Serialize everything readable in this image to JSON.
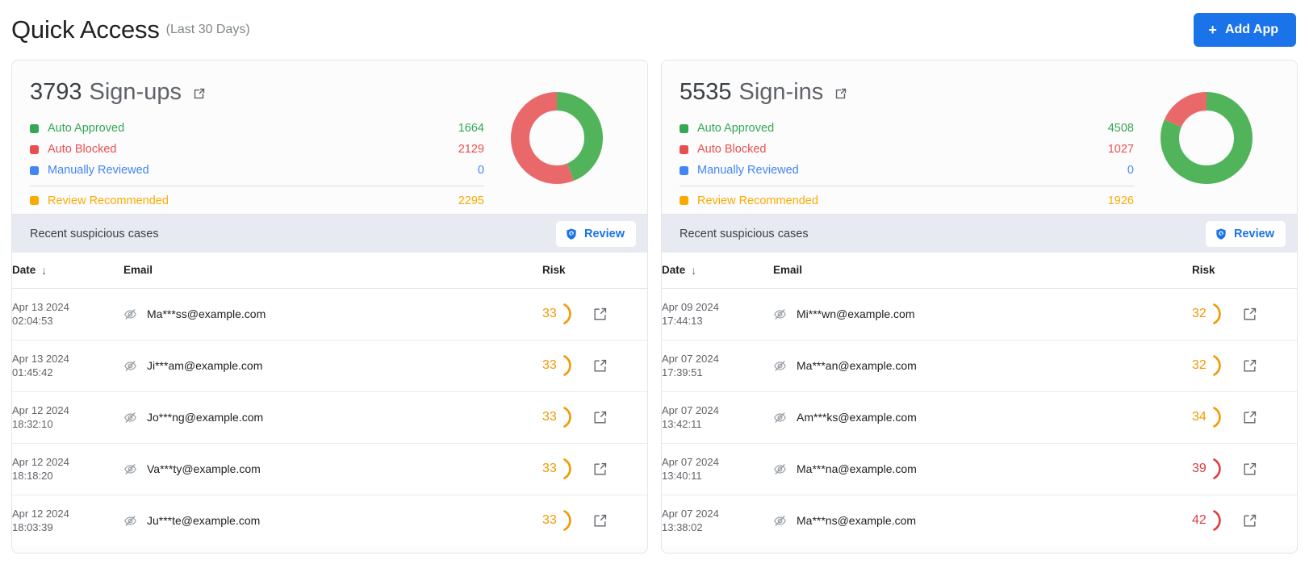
{
  "header": {
    "title": "Quick Access",
    "subtitle": "(Last 30 Days)",
    "add_app_label": "Add App",
    "add_app_plus": "+",
    "accent_color": "#1a73e8"
  },
  "colors": {
    "green": "#34a853",
    "green_chart": "#52b45a",
    "red": "#ea4f50",
    "red_chart": "#e9696b",
    "blue": "#4285f4",
    "orange": "#f9ab00",
    "risk_orange": "#f29900",
    "risk_red": "#e03e3e"
  },
  "cards": [
    {
      "metric_value": "3793",
      "metric_label": "Sign-ups",
      "open_icon": "external-link-icon",
      "legend": [
        {
          "label": "Auto Approved",
          "value": "1664",
          "color": "#34a853",
          "swatch": "#34a853",
          "divider": false
        },
        {
          "label": "Auto Blocked",
          "value": "2129",
          "color": "#ea4f50",
          "swatch": "#ea4f50",
          "divider": false
        },
        {
          "label": "Manually Reviewed",
          "value": "0",
          "color": "#4285f4",
          "swatch": "#4285f4",
          "divider": false
        },
        {
          "label": "Review Recommended",
          "value": "2295",
          "color": "#f9ab00",
          "swatch": "#f9ab00",
          "divider": true
        }
      ],
      "cases_title": "Recent suspicious cases",
      "review_label": "Review",
      "review_icon": "shield-check-icon",
      "columns": {
        "date": "Date",
        "email": "Email",
        "risk": "Risk",
        "sort": "↓"
      },
      "rows": [
        {
          "date": "Apr 13 2024",
          "time": "02:04:53",
          "email": "Ma***ss@example.com",
          "risk": "33",
          "risk_color": "#f29900"
        },
        {
          "date": "Apr 13 2024",
          "time": "01:45:42",
          "email": "Ji***am@example.com",
          "risk": "33",
          "risk_color": "#f29900"
        },
        {
          "date": "Apr 12 2024",
          "time": "18:32:10",
          "email": "Jo***ng@example.com",
          "risk": "33",
          "risk_color": "#f29900"
        },
        {
          "date": "Apr 12 2024",
          "time": "18:18:20",
          "email": "Va***ty@example.com",
          "risk": "33",
          "risk_color": "#f29900"
        },
        {
          "date": "Apr 12 2024",
          "time": "18:03:39",
          "email": "Ju***te@example.com",
          "risk": "33",
          "risk_color": "#f29900"
        }
      ],
      "chart_data": {
        "type": "pie",
        "title": "Sign-ups breakdown",
        "total": 3793,
        "categories": [
          "Auto Approved",
          "Auto Blocked",
          "Manually Reviewed"
        ],
        "values": [
          1664,
          2129,
          0
        ],
        "colors": [
          "#52b45a",
          "#e9696b",
          "#4285f4"
        ],
        "percentages": [
          43.9,
          56.1,
          0
        ],
        "donut": true,
        "legend_position": "left"
      }
    },
    {
      "metric_value": "5535",
      "metric_label": "Sign-ins",
      "open_icon": "external-link-icon",
      "legend": [
        {
          "label": "Auto Approved",
          "value": "4508",
          "color": "#34a853",
          "swatch": "#34a853",
          "divider": false
        },
        {
          "label": "Auto Blocked",
          "value": "1027",
          "color": "#ea4f50",
          "swatch": "#ea4f50",
          "divider": false
        },
        {
          "label": "Manually Reviewed",
          "value": "0",
          "color": "#4285f4",
          "swatch": "#4285f4",
          "divider": false
        },
        {
          "label": "Review Recommended",
          "value": "1926",
          "color": "#f9ab00",
          "swatch": "#f9ab00",
          "divider": true
        }
      ],
      "cases_title": "Recent suspicious cases",
      "review_label": "Review",
      "review_icon": "shield-check-icon",
      "columns": {
        "date": "Date",
        "email": "Email",
        "risk": "Risk",
        "sort": "↓"
      },
      "rows": [
        {
          "date": "Apr 09 2024",
          "time": "17:44:13",
          "email": "Mi***wn@example.com",
          "risk": "32",
          "risk_color": "#f29900"
        },
        {
          "date": "Apr 07 2024",
          "time": "17:39:51",
          "email": "Ma***an@example.com",
          "risk": "32",
          "risk_color": "#f29900"
        },
        {
          "date": "Apr 07 2024",
          "time": "13:42:11",
          "email": "Am***ks@example.com",
          "risk": "34",
          "risk_color": "#f29900"
        },
        {
          "date": "Apr 07 2024",
          "time": "13:40:11",
          "email": "Ma***na@example.com",
          "risk": "39",
          "risk_color": "#e03e3e"
        },
        {
          "date": "Apr 07 2024",
          "time": "13:38:02",
          "email": "Ma***ns@example.com",
          "risk": "42",
          "risk_color": "#e03e3e"
        }
      ],
      "chart_data": {
        "type": "pie",
        "title": "Sign-ins breakdown",
        "total": 5535,
        "categories": [
          "Auto Approved",
          "Auto Blocked",
          "Manually Reviewed"
        ],
        "values": [
          4508,
          1027,
          0
        ],
        "colors": [
          "#52b45a",
          "#e9696b",
          "#4285f4"
        ],
        "percentages": [
          81.4,
          18.6,
          0
        ],
        "donut": true,
        "legend_position": "left"
      }
    }
  ]
}
